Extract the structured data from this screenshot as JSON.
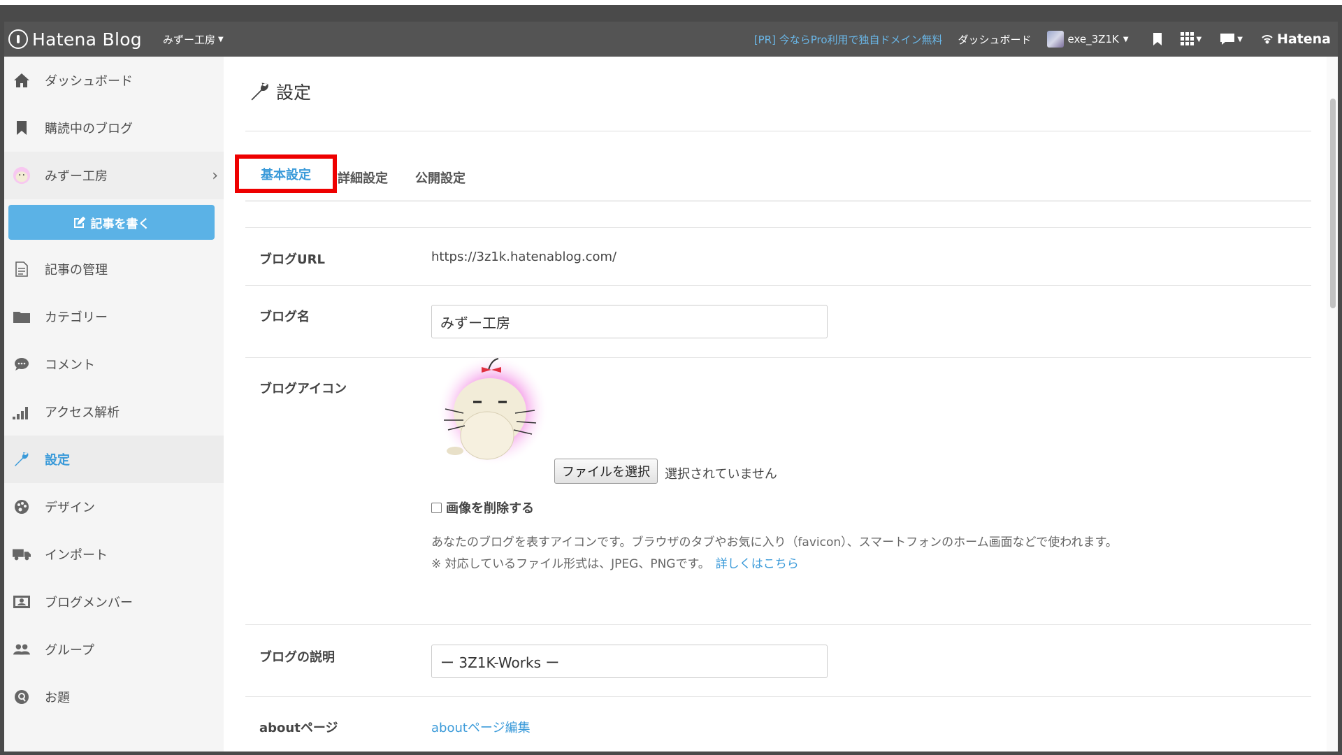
{
  "topbar": {
    "logo_text": "Hatena Blog",
    "blog_switch": "みずー工房",
    "pr_link": "[PR] 今ならPro利用で独自ドメイン無料",
    "dashboard": "ダッシュボード",
    "user": "exe_3Z1K",
    "brand": "Hatena",
    "icons": [
      "bookmark-icon",
      "grid-icon",
      "chat-icon"
    ]
  },
  "sidebar": {
    "items": [
      {
        "label": "ダッシュボード",
        "icon": "home-icon"
      },
      {
        "label": "購読中のブログ",
        "icon": "bookmark-icon"
      },
      {
        "label": "みずー工房",
        "icon": "blog-avatar-icon"
      },
      {
        "label": "記事の管理",
        "icon": "document-icon"
      },
      {
        "label": "カテゴリー",
        "icon": "folder-icon"
      },
      {
        "label": "コメント",
        "icon": "comment-icon"
      },
      {
        "label": "アクセス解析",
        "icon": "bars-icon"
      },
      {
        "label": "設定",
        "icon": "wrench-icon"
      },
      {
        "label": "デザイン",
        "icon": "palette-icon"
      },
      {
        "label": "インポート",
        "icon": "truck-icon"
      },
      {
        "label": "ブログメンバー",
        "icon": "member-icon"
      },
      {
        "label": "グループ",
        "icon": "group-icon"
      },
      {
        "label": "お題",
        "icon": "question-icon"
      }
    ],
    "write_button": "記事を書く"
  },
  "main": {
    "title": "設定",
    "tabs": [
      "基本設定",
      "詳細設定",
      "公開設定"
    ],
    "fields": {
      "url_label": "ブログURL",
      "url_value": "https://3z1k.hatenablog.com/",
      "name_label": "ブログ名",
      "name_value": "みずー工房",
      "icon_label": "ブログアイコン",
      "file_button": "ファイルを選択",
      "file_status": "選択されていません",
      "delete_image": "画像を削除する",
      "icon_help": "あなたのブログを表すアイコンです。ブラウザのタブやお気に入り（favicon）、スマートフォンのホーム画面などで使われます。",
      "icon_note": "※ 対応しているファイル形式は、JPEG、PNGです。",
      "icon_note_link": "詳しくはこちら",
      "desc_label": "ブログの説明",
      "desc_value": "ー 3Z1K-Works ー",
      "about_label": "aboutページ",
      "about_link": "aboutページ編集"
    }
  },
  "colors": {
    "topbar": "#545454",
    "accent": "#3a9ad9",
    "write_button": "#5bb2e6",
    "highlight_box": "#ee0000"
  }
}
